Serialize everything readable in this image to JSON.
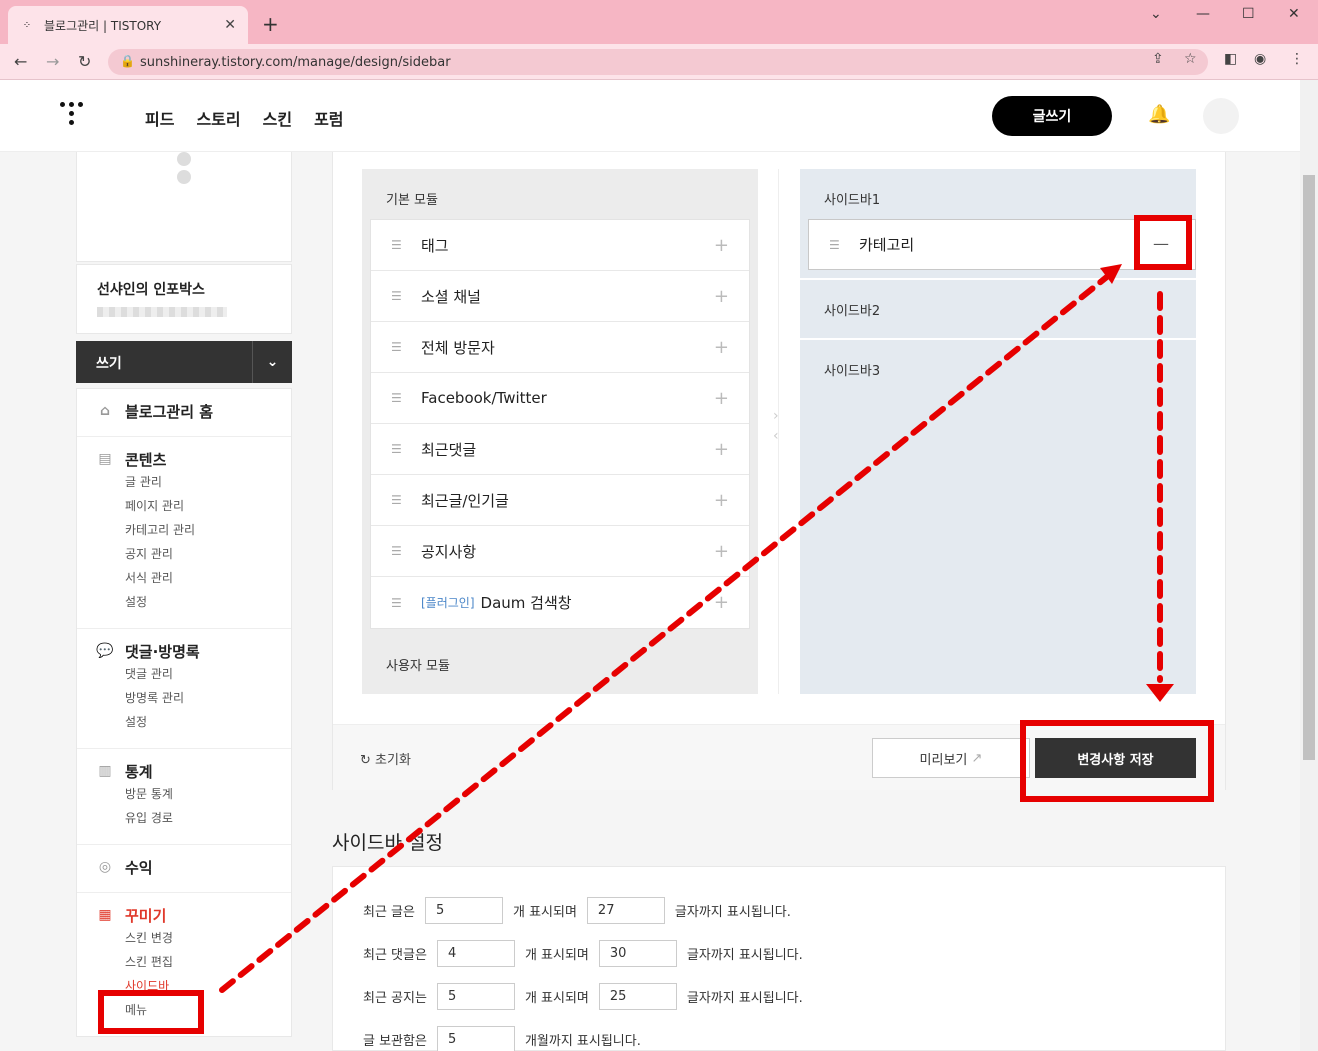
{
  "browser": {
    "tab_title": "블로그관리 | TISTORY",
    "url": "sunshineray.tistory.com/manage/design/sidebar"
  },
  "header": {
    "nav": [
      "피드",
      "스토리",
      "스킨",
      "포럼"
    ],
    "write_button": "글쓰기"
  },
  "sidebar": {
    "blog_name": "선샤인의 인포박스",
    "write_bar": "쓰기",
    "home": "블로그관리 홈",
    "sections": [
      {
        "title": "콘텐츠",
        "icon": "document-icon",
        "items": [
          "글 관리",
          "페이지 관리",
          "카테고리 관리",
          "공지 관리",
          "서식 관리",
          "설정"
        ]
      },
      {
        "title": "댓글·방명록",
        "icon": "comment-icon",
        "items": [
          "댓글 관리",
          "방명록 관리",
          "설정"
        ]
      },
      {
        "title": "통계",
        "icon": "chart-icon",
        "items": [
          "방문 통계",
          "유입 경로"
        ]
      },
      {
        "title": "수익",
        "icon": "coins-icon",
        "items": []
      },
      {
        "title": "꾸미기",
        "icon": "layout-icon",
        "items": [
          "스킨 변경",
          "스킨 편집",
          "사이드바",
          "메뉴"
        ]
      }
    ]
  },
  "modules": {
    "basic_label": "기본 모듈",
    "items": [
      {
        "tag": "",
        "name": "태그"
      },
      {
        "tag": "",
        "name": "소셜 채널"
      },
      {
        "tag": "",
        "name": "전체 방문자"
      },
      {
        "tag": "",
        "name": "Facebook/Twitter"
      },
      {
        "tag": "",
        "name": "최근댓글"
      },
      {
        "tag": "",
        "name": "최근글/인기글"
      },
      {
        "tag": "",
        "name": "공지사항"
      },
      {
        "tag": "[플러그인]",
        "name": "Daum 검색창"
      }
    ],
    "user_label": "사용자 모듈"
  },
  "sidebars": {
    "sidebar1": "사이드바1",
    "sidebar1_item": "카테고리",
    "sidebar2": "사이드바2",
    "sidebar3": "사이드바3"
  },
  "actions": {
    "reset": "초기화",
    "preview": "미리보기",
    "save": "변경사항 저장"
  },
  "settings": {
    "title": "사이드바 설정",
    "rows": [
      {
        "label": "최근 글은",
        "count": "5",
        "mid": "개 표시되며",
        "chars": "27",
        "end": "글자까지 표시됩니다."
      },
      {
        "label": "최근 댓글은",
        "count": "4",
        "mid": "개 표시되며",
        "chars": "30",
        "end": "글자까지 표시됩니다."
      },
      {
        "label": "최근 공지는",
        "count": "5",
        "mid": "개 표시되며",
        "chars": "25",
        "end": "글자까지 표시됩니다."
      },
      {
        "label": "글 보관함은",
        "count": "5",
        "mid": "개월까지 표시됩니다.",
        "chars": "",
        "end": ""
      }
    ]
  },
  "colors": {
    "accent": "#e0392b",
    "annotation": "#e60000"
  }
}
